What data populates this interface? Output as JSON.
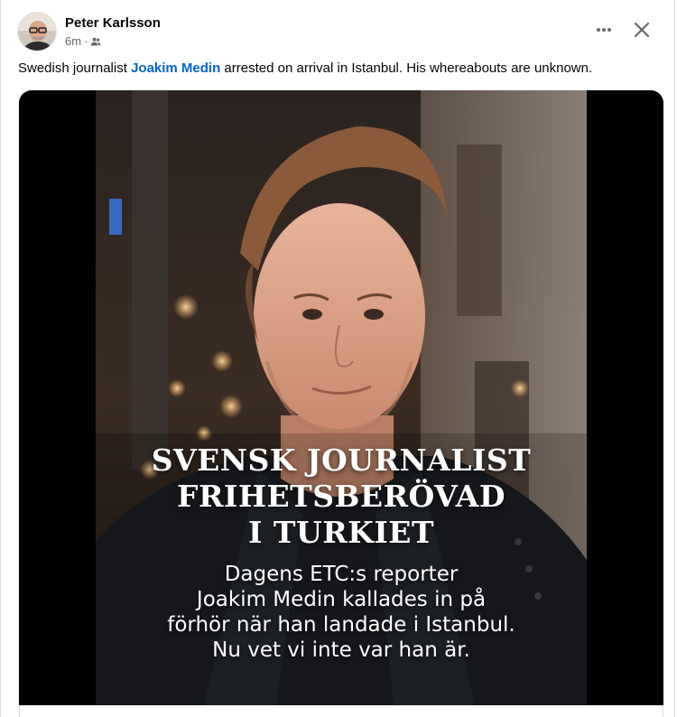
{
  "post": {
    "author": "Peter Karlsson",
    "time": "6m",
    "separator": "·",
    "audience_icon": "friends-icon",
    "caption": {
      "before": "Swedish journalist ",
      "tag": "Joakim Medin",
      "after": " arrested on arrival in Istanbul. His whereabouts are unknown."
    },
    "actions": {
      "more_icon": "more-horizontal-icon",
      "close_icon": "close-icon"
    }
  },
  "image": {
    "headline_lines": [
      "SVENSK JOURNALIST",
      "FRIHETSBERÖVAD",
      "I TURKIET"
    ],
    "sub_lines": [
      "Dagens ETC:s reporter",
      "Joakim Medin kallades in på",
      "förhör när han landade i Istanbul.",
      "Nu vet vi inte var han är."
    ]
  },
  "colors": {
    "link": "#0064d1",
    "secondary_text": "#65676b",
    "border": "#dadde1"
  }
}
